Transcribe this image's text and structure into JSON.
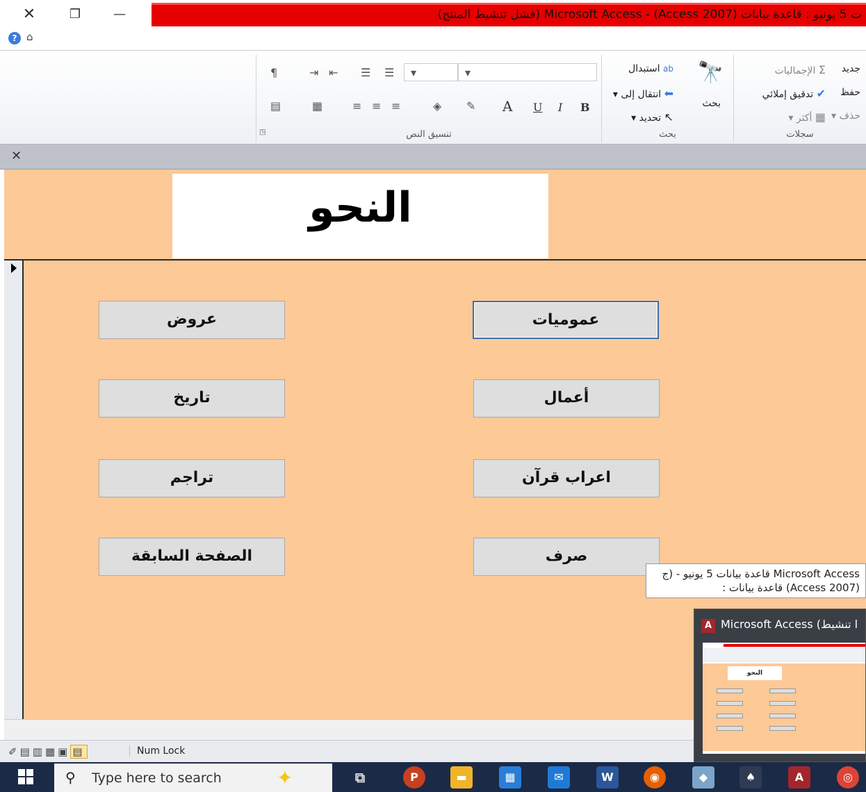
{
  "window": {
    "title": "ت 5 يونيو : قاعدة بيانات (Access 2007) - Microsoft Access (فشل تنشيط المنتج)",
    "close_glyph": "✕",
    "restore_glyph": "❐",
    "minimize_glyph": "—"
  },
  "ribbon": {
    "records_group": {
      "label": "سجلات",
      "new": "جديد",
      "save": "حفظ",
      "delete": "حذف",
      "totals": "الإجماليات",
      "spelling": "تدقيق إملائي",
      "more": "أكثر"
    },
    "find_group": {
      "label": "بحث",
      "find": "بحث",
      "replace": "استبدال",
      "goto": "انتقال إلى",
      "select": "تحديد"
    },
    "text_format_group": {
      "label": "تنسيق النص",
      "bold": "B",
      "italic": "I",
      "underline": "U",
      "font_color": "A"
    }
  },
  "form": {
    "title": "النحو",
    "buttons": {
      "generalities": "عموميات",
      "prosody": "عروض",
      "works": "أعمال",
      "history": "تاريخ",
      "quran_parsing": "اعراب قرآن",
      "biographies": "تراجم",
      "morphology": "صرف",
      "previous_page": "الصفحة السابقة"
    }
  },
  "statusbar": {
    "num_lock": "Num Lock"
  },
  "tooltip": {
    "line1": "Microsoft Access قاعدة بيانات 5 يونيو - (ج",
    "line2": "(Access 2007) قاعدة بيانات :"
  },
  "preview": {
    "title": "Microsoft Access (ا تنشيط",
    "app_letter": "A",
    "thumb_title": "النحو"
  },
  "taskbar": {
    "search_placeholder": "Type here to search"
  }
}
